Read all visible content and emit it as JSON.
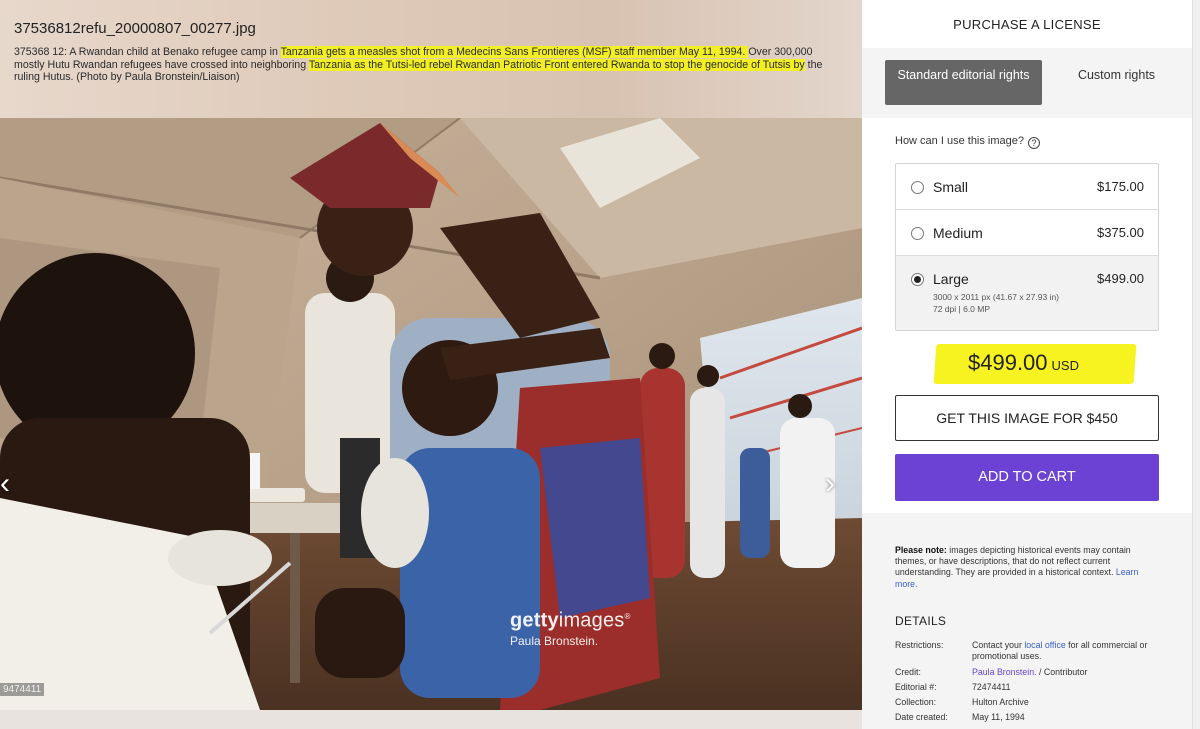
{
  "header": {
    "filename": "37536812refu_20000807_00277.jpg",
    "caption_parts": [
      {
        "text": "375368 12: A Rwandan child at Benako refugee camp in ",
        "highlight": false
      },
      {
        "text": "Tanzania gets a measles shot from a Medecins Sans Frontieres (MSF) staff member May 11, 1994. ",
        "highlight": true
      },
      {
        "text": "Over 300,000 mostly Hutu Rwandan refugees have crossed into neighboring ",
        "highlight": false
      },
      {
        "text": "Tanzania as the Tutsi-led rebel Rwandan Patriotic Front entered Rwanda to stop the genocide of Tutsis by",
        "highlight": true
      },
      {
        "text": " the ruling Hutus. (Photo by Paula Bronstein/Liaison)",
        "highlight": false
      }
    ]
  },
  "image": {
    "watermark_brand_bold": "getty",
    "watermark_brand_light": "images",
    "watermark_reg": "®",
    "watermark_credit": "Paula Bronstein.",
    "id_tag": "9474411",
    "prev_icon": "chevron-left-icon",
    "next_icon": "chevron-right-icon"
  },
  "sidebar": {
    "purchase_heading": "PURCHASE A LICENSE",
    "tab_standard": "Standard editorial rights",
    "tab_custom": "Custom rights",
    "how_use": "How can I use this image?",
    "help_glyph": "?",
    "sizes": [
      {
        "label": "Small",
        "price": "$175.00",
        "selected": false
      },
      {
        "label": "Medium",
        "price": "$375.00",
        "selected": false
      },
      {
        "label": "Large",
        "price": "$499.00",
        "selected": true,
        "detail_1": "3000 x 2011 px (41.67 x 27.93 in)",
        "detail_2": "72 dpi | 6.0 MP"
      }
    ],
    "total_price": "$499.00",
    "currency": "USD",
    "get_image_label": "GET THIS IMAGE FOR $450",
    "add_to_cart_label": "ADD TO CART",
    "note_label": "Please note:",
    "note_text": " images depicting historical events may contain themes, or have descriptions, that do not reflect current understanding. They are provided in a historical context. ",
    "note_link": "Learn more.",
    "details_title": "DETAILS",
    "details": {
      "restrictions_key": "Restrictions:",
      "restrictions_pre": "Contact your ",
      "restrictions_link": "local office",
      "restrictions_post": " for all commercial or promotional uses.",
      "credit_key": "Credit:",
      "credit_name": "Paula Bronstein.",
      "credit_suffix": " / Contributor",
      "editorial_key": "Editorial #:",
      "editorial_val": "72474411",
      "collection_key": "Collection:",
      "collection_val": "Hulton Archive",
      "date_key": "Date created:",
      "date_val": "May 11, 1994"
    }
  },
  "colors": {
    "accent_purple": "#6c42d4",
    "highlight_yellow": "#f3ef26",
    "tab_selected": "#666666"
  }
}
